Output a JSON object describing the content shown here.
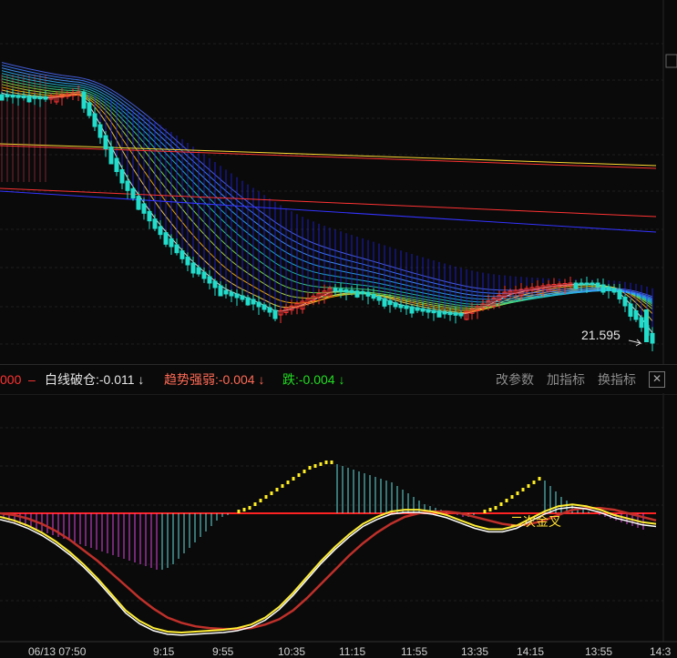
{
  "indicator_bar": {
    "prefix": "000",
    "items": [
      {
        "label": "白线破仓:",
        "value": "-0.011",
        "arrow": "↓",
        "color": "#e6e6e6"
      },
      {
        "label": "趋势强弱:",
        "value": "-0.004",
        "arrow": "↓",
        "color": "#ff6a55"
      },
      {
        "label": "跌:",
        "value": "-0.004",
        "arrow": "↓",
        "color": "#22dd22"
      }
    ],
    "buttons": [
      "改参数",
      "加指标",
      "换指标"
    ]
  },
  "price_label": "21.595",
  "cross_annotation": "二次金叉",
  "time_axis": [
    "06/13 07:50",
    "9:15",
    "9:55",
    "10:35",
    "11:15",
    "11:55",
    "13:35",
    "14:15",
    "13:55",
    "14:3"
  ],
  "colors": {
    "background": "#0a0a0a",
    "rising": "#ff3333",
    "falling": "#22ddcc",
    "dif_line": "#ffffff",
    "dea_line": "#c0302a",
    "zero_line": "#ff2222",
    "long_ma": "#ffdd33",
    "blue_band": "#2222ff"
  },
  "chart_data": [
    {
      "type": "candlestick",
      "panel": "price",
      "x_count": 120,
      "close_path": [
        [
          0,
          105
        ],
        [
          8,
          108
        ],
        [
          14,
          102
        ],
        [
          18,
          150
        ],
        [
          22,
          200
        ],
        [
          28,
          250
        ],
        [
          34,
          290
        ],
        [
          40,
          320
        ],
        [
          45,
          330
        ],
        [
          50,
          345
        ],
        [
          55,
          332
        ],
        [
          60,
          318
        ],
        [
          66,
          322
        ],
        [
          72,
          336
        ],
        [
          78,
          342
        ],
        [
          84,
          346
        ],
        [
          88,
          335
        ],
        [
          92,
          322
        ],
        [
          96,
          318
        ],
        [
          100,
          314
        ],
        [
          104,
          312
        ],
        [
          108,
          312
        ],
        [
          112,
          320
        ],
        [
          116,
          350
        ],
        [
          119,
          376
        ]
      ],
      "moving_averages": [
        {
          "name": "MA-long-1",
          "start": 158,
          "end": 182,
          "color": "#ffdd33"
        },
        {
          "name": "MA-long-2",
          "start": 160,
          "end": 185,
          "color": "#ff3333"
        },
        {
          "name": "MA-long-3",
          "start": 207,
          "end": 238,
          "color": "#ff3333"
        },
        {
          "name": "MA-long-4",
          "start": 210,
          "end": 255,
          "color": "#3333ff"
        }
      ]
    },
    {
      "type": "bar",
      "panel": "macd",
      "zero_line": true,
      "histogram": [
        -6,
        -8,
        -10,
        -12,
        -14,
        -16,
        -18,
        -20,
        -22,
        -24,
        -26,
        -28,
        -30,
        -32,
        -34,
        -36,
        -38,
        -40,
        -42,
        -44,
        -46,
        -48,
        -50,
        -52,
        -54,
        -56,
        -58,
        -60,
        -62,
        -62,
        -60,
        -56,
        -50,
        -44,
        -38,
        -32,
        -26,
        -20,
        -14,
        -8,
        -4,
        -2,
        0,
        2,
        4,
        6,
        10,
        14,
        18,
        22,
        26,
        30,
        34,
        38,
        42,
        46,
        50,
        52,
        54,
        56,
        56,
        54,
        52,
        50,
        48,
        46,
        44,
        42,
        40,
        38,
        36,
        34,
        30,
        26,
        22,
        18,
        14,
        10,
        8,
        6,
        4,
        2,
        0,
        -2,
        -4,
        -4,
        -2,
        0,
        2,
        4,
        6,
        10,
        14,
        18,
        22,
        26,
        30,
        34,
        38,
        36,
        30,
        24,
        18,
        14,
        10,
        6,
        4,
        2,
        0,
        -2,
        -4,
        -6,
        -8,
        -10,
        -12,
        -14,
        -16,
        -18
      ],
      "dif": [
        -4,
        -8,
        -14,
        -22,
        -32,
        -44,
        -58,
        -74,
        -92,
        -110,
        -122,
        -130,
        -134,
        -135,
        -134,
        -133,
        -132,
        -130,
        -126,
        -118,
        -106,
        -90,
        -72,
        -54,
        -38,
        -24,
        -12,
        -4,
        2,
        4,
        4,
        2,
        -2,
        -8,
        -14,
        -18,
        -18,
        -14,
        -6,
        2,
        8,
        10,
        8,
        4,
        -2,
        -6,
        -10,
        -12
      ],
      "dea": [
        0,
        -2,
        -6,
        -12,
        -20,
        -30,
        -42,
        -54,
        -68,
        -82,
        -96,
        -108,
        -118,
        -124,
        -128,
        -130,
        -131,
        -131,
        -130,
        -126,
        -120,
        -110,
        -96,
        -80,
        -64,
        -48,
        -34,
        -22,
        -12,
        -4,
        0,
        2,
        2,
        0,
        -4,
        -8,
        -12,
        -14,
        -12,
        -8,
        -2,
        4,
        6,
        6,
        4,
        0,
        -4,
        -8
      ]
    }
  ]
}
